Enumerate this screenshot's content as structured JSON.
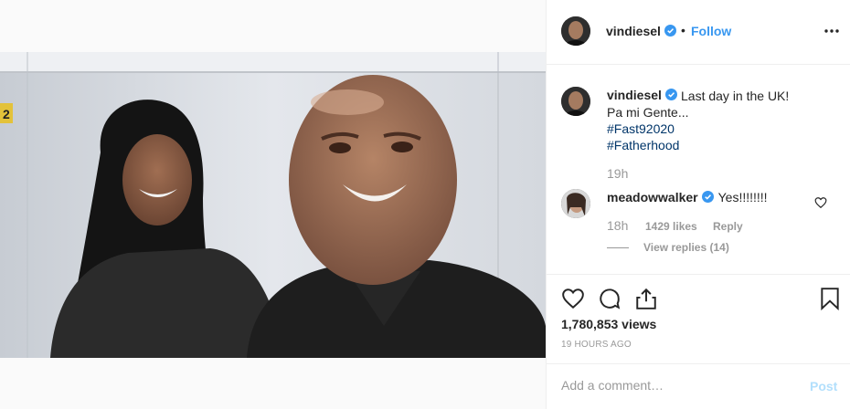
{
  "post": {
    "username": "vindiesel",
    "follow_label": "Follow",
    "dot": "•",
    "caption_lines": [
      "Last day in the UK!",
      "Pa mi Gente..."
    ],
    "hashtags": [
      "#Fast92020",
      "#Fatherhood"
    ],
    "caption_time": "19h"
  },
  "comment": {
    "username": "meadowwalker",
    "text": "Yes!!!!!!!!",
    "time": "18h",
    "likes": "1429 likes",
    "reply_label": "Reply",
    "view_replies": "View replies (14)"
  },
  "stats": {
    "views": "1,780,853 views",
    "posted": "19 HOURS AGO"
  },
  "composer": {
    "placeholder": "Add a comment…",
    "post_label": "Post"
  },
  "video": {
    "background_label": "2"
  },
  "icons": {
    "verified": "verified-badge-icon",
    "more": "more-options-icon",
    "like": "heart-icon",
    "comment": "comment-bubble-icon",
    "share": "share-icon",
    "save": "bookmark-icon"
  },
  "colors": {
    "link": "#3897f0",
    "hashtag": "#003569",
    "muted": "#999999",
    "post_disabled": "#b2dffc"
  }
}
